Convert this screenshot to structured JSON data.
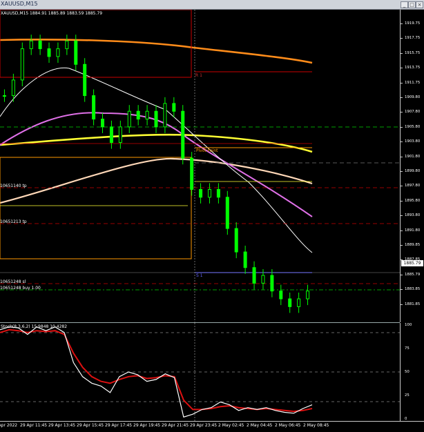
{
  "window": {
    "title": "XAUUSD,M15",
    "buttons": [
      "_",
      "□",
      "×"
    ]
  },
  "chart_info": "XAUUSD,M15  1884.91 1885.89 1883.59 1885.79",
  "price_axis": [
    "1919.75",
    "1917.75",
    "1915.75",
    "1913.75",
    "1911.75",
    "1909.80",
    "1907.80",
    "1905.80",
    "1903.80",
    "1901.80",
    "1899.80",
    "1897.80",
    "1895.80",
    "1893.80",
    "1891.80",
    "1889.85",
    "1887.85",
    "1885.79",
    "1883.85",
    "1881.85"
  ],
  "current_price": "1885.79",
  "levels": {
    "r1": "R 1",
    "pivot": "Pivot Point",
    "s1": "S 1"
  },
  "order_labels": {
    "tp1": "10651140 tp",
    "tp2": "10651213 tp",
    "sl": "10651248 sl",
    "buy": "10651248 buy 1.00"
  },
  "oscillator": {
    "label": "Stoch(8,3,6,2) 15.9848 10.4282",
    "axis": [
      "100",
      "75",
      "50",
      "25",
      "0"
    ]
  },
  "time_axis": [
    "29 Apr 2022",
    "29 Apr 11:45",
    "29 Apr 13:45",
    "29 Apr 15:45",
    "29 Apr 17:45",
    "29 Apr 19:45",
    "29 Apr 21:45",
    "29 Apr 23:45",
    "2 May 02:45",
    "2 May 04:45",
    "2 May 06:45",
    "2 May 08:45"
  ],
  "colors": {
    "candle": "#00ff00",
    "ma_orange": "#ff8c1a",
    "ma_yellow": "#ffff33",
    "ma_peach": "#ffd8b8",
    "ma_violet": "#e070e8",
    "ma_white": "#ffffff",
    "stoch_main": "#ffffff",
    "stoch_signal": "#dd1111",
    "pivot": "#ff9900",
    "resistance": "#cc0000",
    "support": "#4444ff"
  },
  "chart_data": {
    "type": "line",
    "title": "XAUUSD,M15",
    "ylim": [
      1881,
      1921
    ],
    "series": [
      {
        "values": [
          1910,
          1912,
          1916,
          1917,
          1916,
          1915,
          1916,
          1917,
          1914,
          1910,
          1907,
          1906,
          1904,
          1906,
          1908,
          1907,
          1908,
          1906,
          1909,
          1908,
          1902,
          1898,
          1897,
          1898,
          1897,
          1893,
          1890,
          1888,
          1886,
          1887,
          1885,
          1884,
          1883,
          1884,
          1885
        ]
      }
    ],
    "oscillator_series": [
      {
        "name": "Stoch main",
        "values": [
          95,
          98,
          97,
          90,
          98,
          94,
          98,
          92,
          60,
          45,
          38,
          35,
          28,
          45,
          50,
          47,
          40,
          42,
          48,
          44,
          2,
          5,
          10,
          12,
          18,
          15,
          9,
          12,
          10,
          12,
          9,
          7,
          6,
          11,
          15
        ]
      },
      {
        "name": "Stoch signal",
        "values": [
          92,
          95,
          94,
          92,
          94,
          93,
          94,
          90,
          70,
          55,
          45,
          40,
          38,
          42,
          45,
          46,
          43,
          44,
          46,
          45,
          20,
          10,
          10,
          11,
          13,
          14,
          12,
          11,
          10,
          11,
          10,
          9,
          8,
          9,
          11
        ]
      }
    ]
  }
}
